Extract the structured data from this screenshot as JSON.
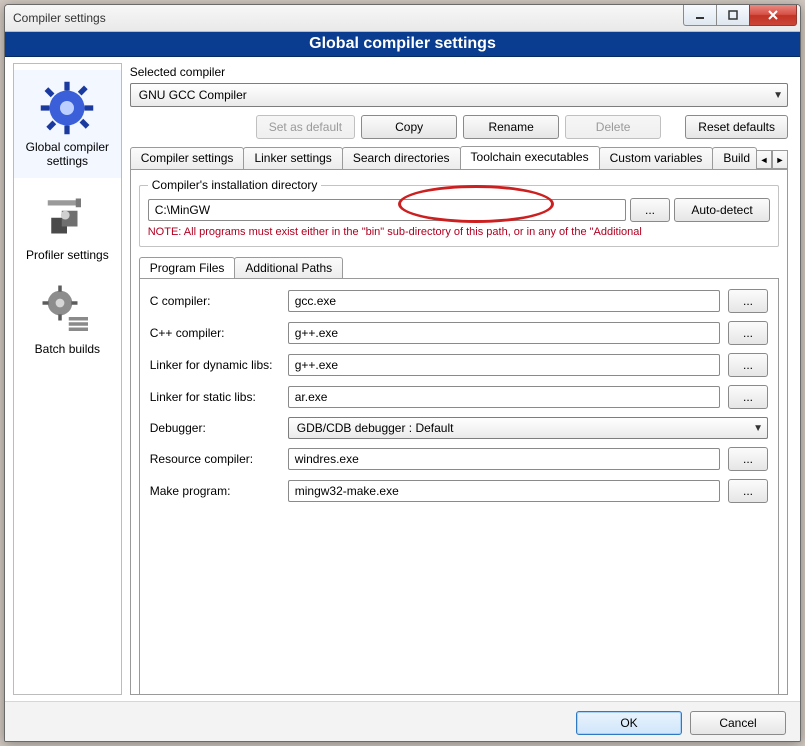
{
  "window": {
    "title": "Compiler settings"
  },
  "banner": {
    "title": "Global compiler settings"
  },
  "sidebar": {
    "items": [
      {
        "label": "Global compiler settings"
      },
      {
        "label": "Profiler settings"
      },
      {
        "label": "Batch builds"
      }
    ]
  },
  "selected_compiler": {
    "label": "Selected compiler",
    "value": "GNU GCC Compiler",
    "buttons": {
      "set_default": "Set as default",
      "copy": "Copy",
      "rename": "Rename",
      "delete": "Delete",
      "reset": "Reset defaults"
    }
  },
  "tabs": {
    "items": [
      "Compiler settings",
      "Linker settings",
      "Search directories",
      "Toolchain executables",
      "Custom variables",
      "Build"
    ],
    "active_index": 3
  },
  "install_dir_group": {
    "legend": "Compiler's installation directory",
    "path": "C:\\MinGW",
    "browse": "...",
    "autodetect": "Auto-detect",
    "note": "NOTE: All programs must exist either in the \"bin\" sub-directory of this path, or in any of the \"Additional"
  },
  "subtabs": {
    "items": [
      "Program Files",
      "Additional Paths"
    ],
    "active_index": 0
  },
  "program_files": {
    "rows": [
      {
        "label": "C compiler:",
        "value": "gcc.exe",
        "browse": "..."
      },
      {
        "label": "C++ compiler:",
        "value": "g++.exe",
        "browse": "..."
      },
      {
        "label": "Linker for dynamic libs:",
        "value": "g++.exe",
        "browse": "..."
      },
      {
        "label": "Linker for static libs:",
        "value": "ar.exe",
        "browse": "..."
      },
      {
        "label": "Debugger:",
        "value": "GDB/CDB debugger : Default",
        "dropdown": true
      },
      {
        "label": "Resource compiler:",
        "value": "windres.exe",
        "browse": "..."
      },
      {
        "label": "Make program:",
        "value": "mingw32-make.exe",
        "browse": "..."
      }
    ]
  },
  "footer": {
    "ok": "OK",
    "cancel": "Cancel"
  }
}
